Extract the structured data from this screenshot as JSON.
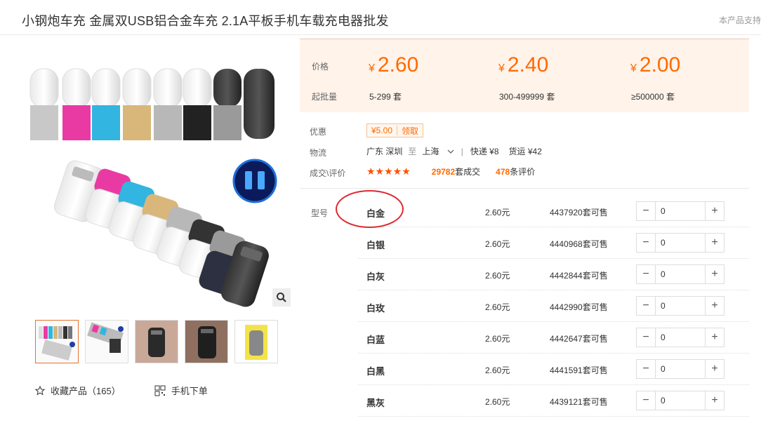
{
  "product": {
    "title": "小钢炮车充 金属双USB铝合金车充 2.1A平板手机车载充电器批发",
    "support_text": "本产品支持"
  },
  "pricing": {
    "price_label": "价格",
    "moq_label": "起批量",
    "currency": "¥",
    "tiers": [
      {
        "price": "2.60",
        "range": "5-299 套"
      },
      {
        "price": "2.40",
        "range": "300-499999 套"
      },
      {
        "price": "2.00",
        "range": "≥500000 套"
      }
    ]
  },
  "details": {
    "discount_label": "优惠",
    "coupon_amount": "¥5.00",
    "coupon_action": "领取",
    "logistics_label": "物流",
    "from": "广东 深圳",
    "to_word": "至",
    "to": "上海",
    "express": "快递 ¥8",
    "freight": "货运 ¥42",
    "trade_label": "成交\\评价",
    "stars": "★★★★★",
    "deals_count": "29782",
    "deals_unit": "套成交",
    "review_count": "478",
    "review_unit": "条评价"
  },
  "sku": {
    "type_label": "型号",
    "items": [
      {
        "name": "白金",
        "price": "2.60元",
        "stock": "4437920套可售",
        "qty": "0"
      },
      {
        "name": "白银",
        "price": "2.60元",
        "stock": "4440968套可售",
        "qty": "0"
      },
      {
        "name": "白灰",
        "price": "2.60元",
        "stock": "4442844套可售",
        "qty": "0"
      },
      {
        "name": "白玫",
        "price": "2.60元",
        "stock": "4442990套可售",
        "qty": "0"
      },
      {
        "name": "白蓝",
        "price": "2.60元",
        "stock": "4442647套可售",
        "qty": "0"
      },
      {
        "name": "白黑",
        "price": "2.60元",
        "stock": "4441591套可售",
        "qty": "0"
      },
      {
        "name": "黑灰",
        "price": "2.60元",
        "stock": "4439121套可售",
        "qty": "0"
      }
    ],
    "minus_symbol": "−",
    "plus_symbol": "+"
  },
  "actions": {
    "favorite_label": "收藏产品（165）",
    "mobile_order_label": "手机下单"
  },
  "colors": {
    "accent": "#ff6a00",
    "price_bg": "#fff3ea",
    "annotation": "#e0282f"
  }
}
